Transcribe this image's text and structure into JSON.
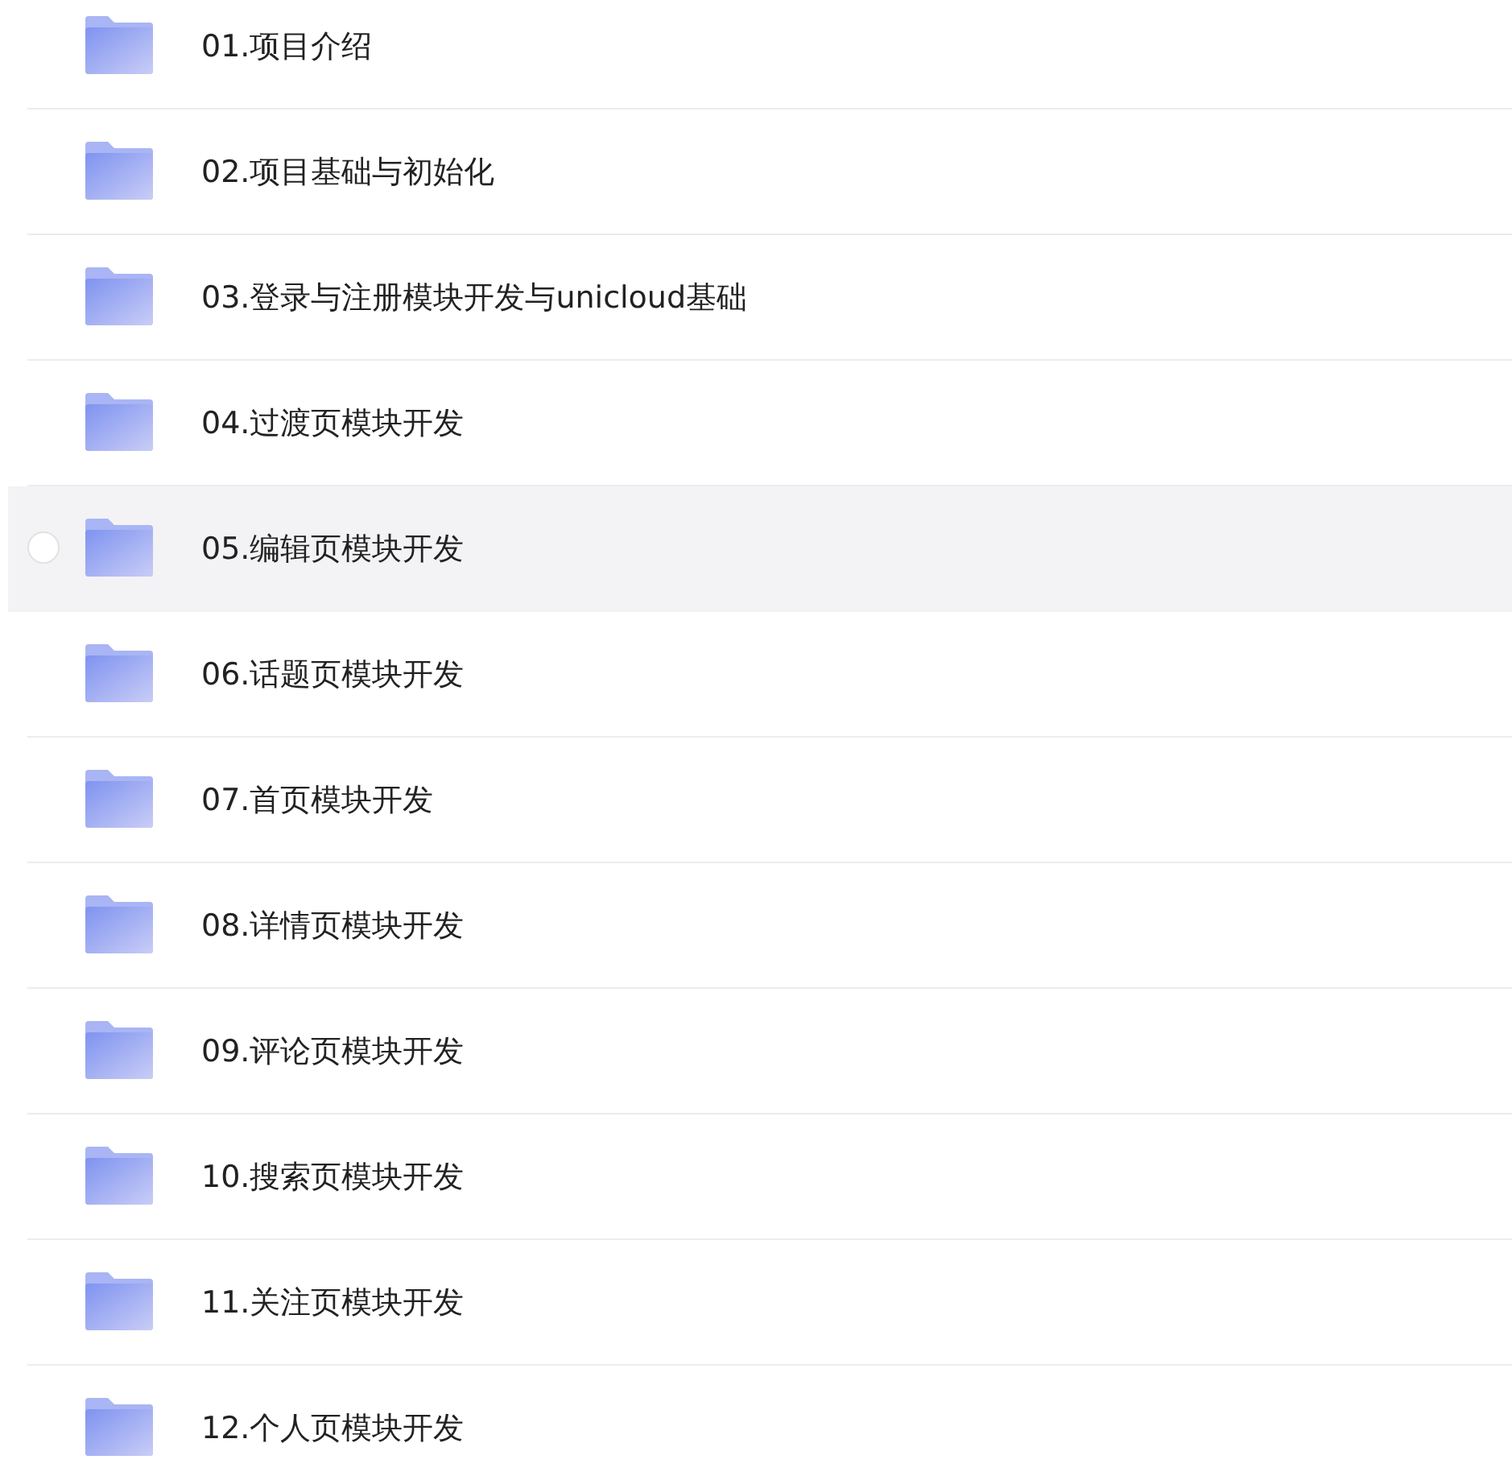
{
  "files": [
    {
      "name": "01.项目介绍",
      "hovered": false
    },
    {
      "name": "02.项目基础与初始化",
      "hovered": false
    },
    {
      "name": "03.登录与注册模块开发与unicloud基础",
      "hovered": false
    },
    {
      "name": "04.过渡页模块开发",
      "hovered": false
    },
    {
      "name": "05.编辑页模块开发",
      "hovered": true
    },
    {
      "name": "06.话题页模块开发",
      "hovered": false
    },
    {
      "name": "07.首页模块开发",
      "hovered": false
    },
    {
      "name": "08.详情页模块开发",
      "hovered": false
    },
    {
      "name": "09.评论页模块开发",
      "hovered": false
    },
    {
      "name": "10.搜索页模块开发",
      "hovered": false
    },
    {
      "name": "11.关注页模块开发",
      "hovered": false
    },
    {
      "name": "12.个人页模块开发",
      "hovered": false
    }
  ]
}
